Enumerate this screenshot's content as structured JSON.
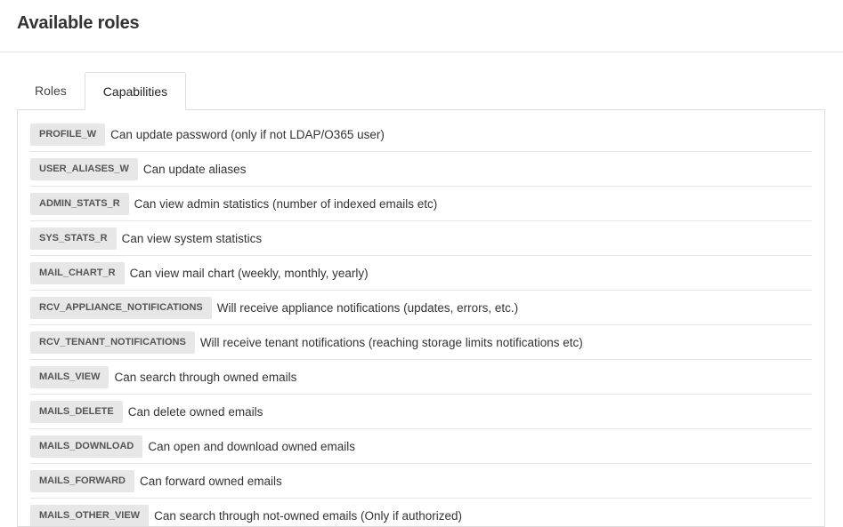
{
  "header": {
    "title": "Available roles"
  },
  "tabs": [
    {
      "label": "Roles",
      "active": false
    },
    {
      "label": "Capabilities",
      "active": true
    }
  ],
  "capabilities": [
    {
      "code": "PROFILE_W",
      "description": "Can update password (only if not LDAP/O365 user)"
    },
    {
      "code": "USER_ALIASES_W",
      "description": "Can update aliases"
    },
    {
      "code": "ADMIN_STATS_R",
      "description": "Can view admin statistics (number of indexed emails etc)"
    },
    {
      "code": "SYS_STATS_R",
      "description": "Can view system statistics"
    },
    {
      "code": "MAIL_CHART_R",
      "description": "Can view mail chart (weekly, monthly, yearly)"
    },
    {
      "code": "RCV_APPLIANCE_NOTIFICATIONS",
      "description": "Will receive appliance notifications (updates, errors, etc.)"
    },
    {
      "code": "RCV_TENANT_NOTIFICATIONS",
      "description": "Will receive tenant notifications (reaching storage limits notifications etc)"
    },
    {
      "code": "MAILS_VIEW",
      "description": "Can search through owned emails"
    },
    {
      "code": "MAILS_DELETE",
      "description": "Can delete owned emails"
    },
    {
      "code": "MAILS_DOWNLOAD",
      "description": "Can open and download owned emails"
    },
    {
      "code": "MAILS_FORWARD",
      "description": "Can forward owned emails"
    },
    {
      "code": "MAILS_OTHER_VIEW",
      "description": "Can search through not-owned emails (Only if authorized)"
    }
  ]
}
